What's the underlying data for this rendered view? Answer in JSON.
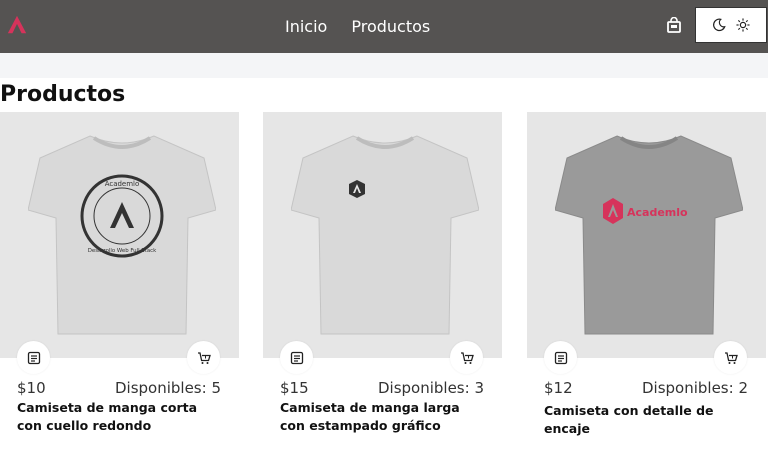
{
  "nav": {
    "logo_icon": "academlo-logo-icon",
    "links": [
      "Inicio",
      "Productos"
    ],
    "bag_icon": "shopping-bag-icon",
    "theme_icons": [
      "moon-icon",
      "sun-icon"
    ]
  },
  "page": {
    "title": "Productos"
  },
  "products": [
    {
      "price": "$10",
      "stock": "Disponibles: 5",
      "name": "Camiseta de manga corta con cuello redondo",
      "shirt_color": "#d9d9d9",
      "print": "circle-seal",
      "print_text": [
        "Academlo",
        "Desarrollo Web Full Stack"
      ]
    },
    {
      "price": "$15",
      "stock": "Disponibles: 3",
      "name": "Camiseta de manga larga con estampado gráfico",
      "shirt_color": "#d9d9d9",
      "print": "small-logo"
    },
    {
      "price": "$12",
      "stock": "Disponibles: 2",
      "name": "Camiseta con detalle de encaje",
      "shirt_color": "#9a9a9a",
      "print": "brand-logo",
      "print_text": [
        "Academlo"
      ]
    }
  ],
  "colors": {
    "header": "#555352",
    "accent": "#d6335b"
  }
}
